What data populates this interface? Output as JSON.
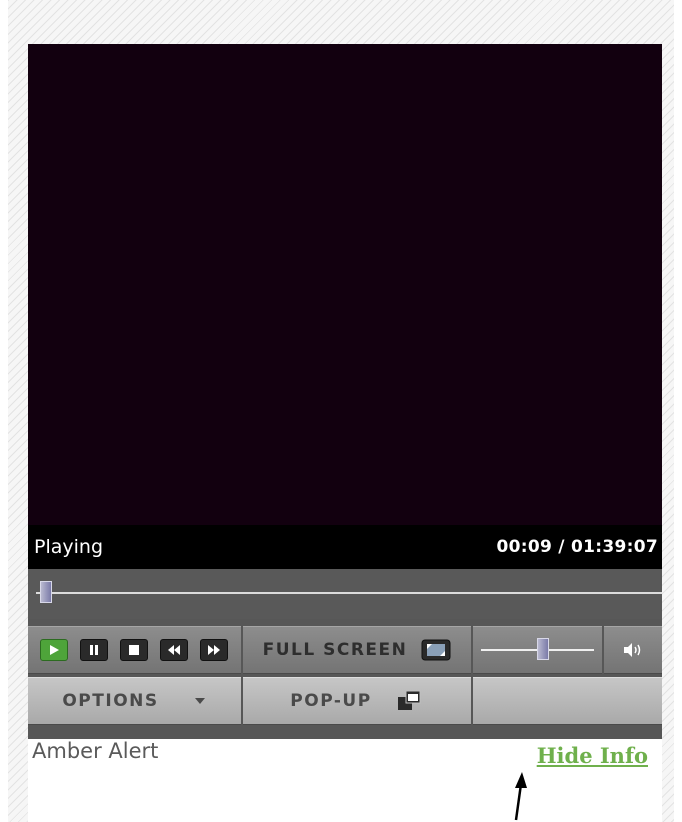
{
  "player": {
    "status": "Playing",
    "time": "00:09 / 01:39:07",
    "seek_progress": 0.01,
    "volume_level": 0.55
  },
  "transport": {
    "buttons": [
      "play-icon",
      "pause-icon",
      "stop-icon",
      "rewind-icon",
      "fast-forward-icon"
    ]
  },
  "toolbar": {
    "fullscreen_label": "FULL SCREEN",
    "options_label": "OPTIONS",
    "popup_label": "POP-UP"
  },
  "info": {
    "title": "Amber Alert",
    "hide_info_label": "Hide Info"
  },
  "colors": {
    "video_bg": "#12000f",
    "play_green": "#4ea43a",
    "link_green": "#6fb04c"
  }
}
